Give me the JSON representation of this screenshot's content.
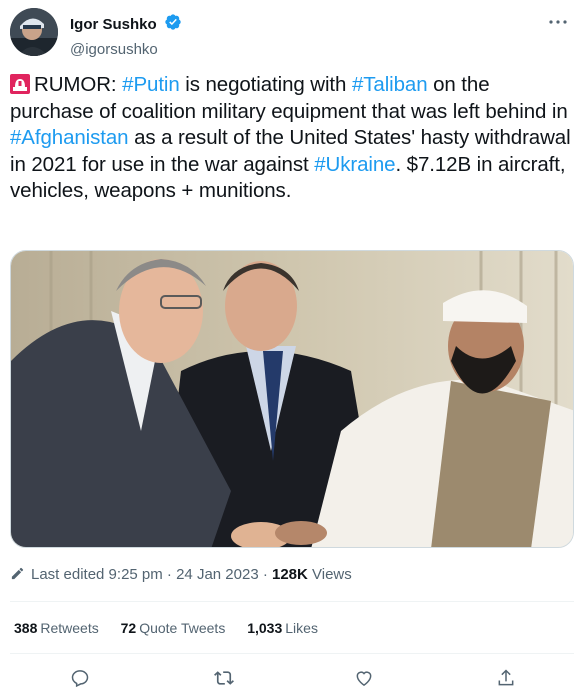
{
  "author": {
    "display_name": "Igor Sushko",
    "handle": "@igorsushko",
    "verified": true,
    "avatar_icon": "avatar-photo"
  },
  "more_icon": "ellipsis-icon",
  "tweet": {
    "emoji": "rotating-light-emoji",
    "segments": [
      {
        "text": "RUMOR: ",
        "type": "text"
      },
      {
        "text": "#Putin",
        "type": "hashtag"
      },
      {
        "text": " is negotiating with ",
        "type": "text"
      },
      {
        "text": "#Taliban",
        "type": "hashtag"
      },
      {
        "text": " on the purchase of coalition military equipment that was left behind in ",
        "type": "text"
      },
      {
        "text": "#Afghanistan",
        "type": "hashtag"
      },
      {
        "text": " as a result of the United States' hasty withdrawal in 2021 for use in the war against ",
        "type": "text"
      },
      {
        "text": "#Ukraine",
        "type": "hashtag"
      },
      {
        "text": ". $7.12B in aircraft, vehicles, weapons + munitions.",
        "type": "text"
      }
    ]
  },
  "meta": {
    "edited_label": "Last edited 9:25 pm · 24 Jan 2023 · ",
    "views_count": "128K",
    "views_label": " Views"
  },
  "stats": {
    "retweets_count": "388",
    "retweets_label": "Retweets",
    "quotes_count": "72",
    "quotes_label": "Quote Tweets",
    "likes_count": "1,033",
    "likes_label": "Likes"
  },
  "actions": [
    "reply-icon",
    "retweet-icon",
    "like-icon",
    "share-icon"
  ],
  "colors": {
    "link": "#1d9bf0",
    "secondary_text": "#536471",
    "verified": "#1d9bf0",
    "alarm_red": "#e0245e"
  }
}
